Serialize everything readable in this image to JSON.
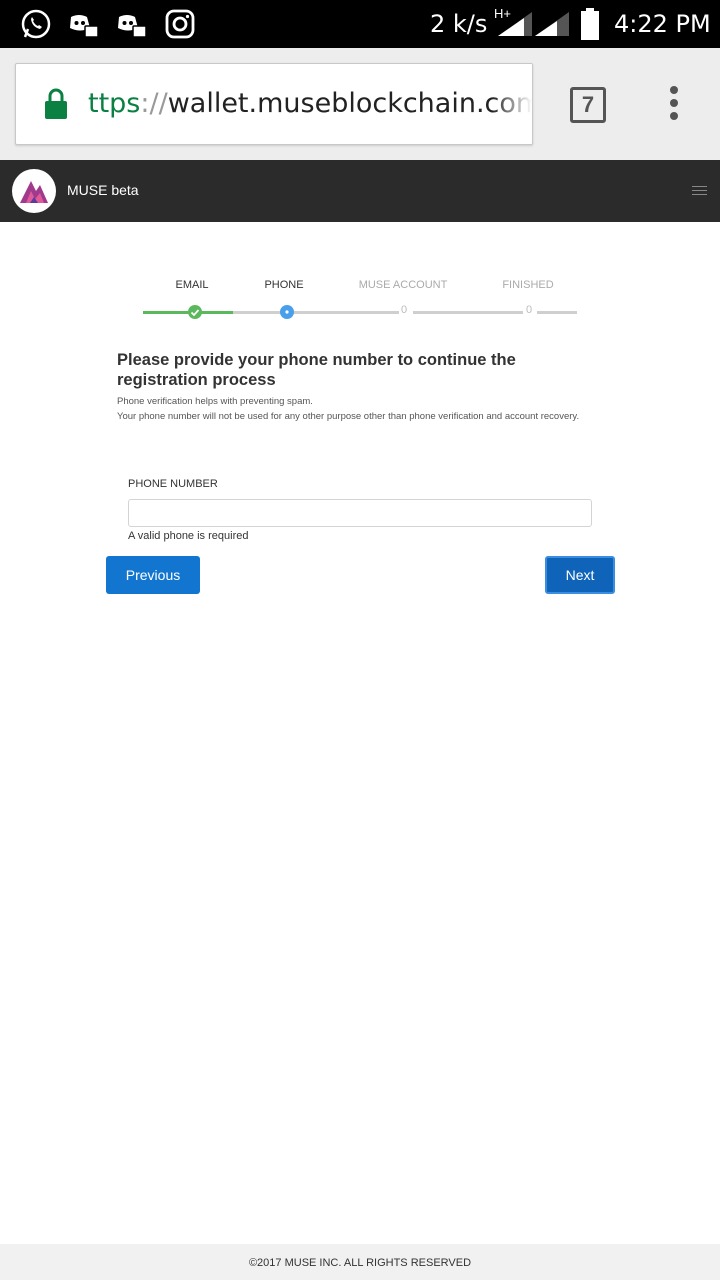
{
  "statusbar": {
    "net_speed": "2 k/s",
    "network_type": "H+",
    "time": "4:22 PM",
    "icons": [
      "whatsapp-icon",
      "discord-icon",
      "discord-icon",
      "instagram-icon",
      "signal-icon",
      "signal-icon",
      "battery-icon"
    ]
  },
  "browser": {
    "url_scheme": "ttps",
    "url_sep": "://",
    "url_host": "wallet.museblockchain.com",
    "url_path": "/#",
    "tab_count": "7"
  },
  "app": {
    "brand": "MUSE beta"
  },
  "steps": [
    {
      "label": "EMAIL",
      "state": "done",
      "marker": "✓"
    },
    {
      "label": "PHONE",
      "state": "active",
      "marker": "•"
    },
    {
      "label": "MUSE ACCOUNT",
      "state": "pending",
      "marker": "0"
    },
    {
      "label": "FINISHED",
      "state": "pending",
      "marker": "0"
    }
  ],
  "form": {
    "heading": "Please provide your phone number to continue the registration process",
    "note_1": "Phone verification helps with preventing spam.",
    "note_2": "Your phone number will not be used for any other purpose other than phone verification and account recovery.",
    "phone_label": "PHONE NUMBER",
    "phone_value": "",
    "error": "A valid phone is required",
    "previous_label": "Previous",
    "next_label": "Next"
  },
  "footer": {
    "copyright": "©2017 MUSE INC. ALL RIGHTS RESERVED"
  },
  "colors": {
    "done": "#5cb85c",
    "active": "#4a9fea",
    "pending": "#c4c4c4",
    "primary_button": "#1276d1"
  }
}
